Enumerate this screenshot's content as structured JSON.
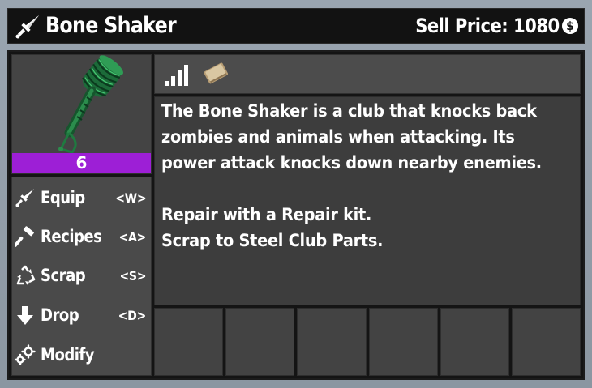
{
  "header": {
    "title": "Bone Shaker",
    "title_icon": "melee-weapon-icon",
    "sell_price_text": "Sell Price: 1080",
    "coin_icon": "dukes-coin-icon"
  },
  "item": {
    "quality_level": "6",
    "quality_color": "#9d1fd6",
    "icon": "bone-shaker-club-icon"
  },
  "stats": {
    "icons": [
      "quality-tier-signal-icon",
      "book-icon"
    ]
  },
  "actions": [
    {
      "label": "Equip",
      "key": "<W>",
      "icon": "sword-icon"
    },
    {
      "label": "Recipes",
      "key": "<A>",
      "icon": "hammer-icon"
    },
    {
      "label": "Scrap",
      "key": "<S>",
      "icon": "recycle-icon"
    },
    {
      "label": "Drop",
      "key": "<D>",
      "icon": "down-arrow-icon"
    },
    {
      "label": "Modify",
      "key": "",
      "icon": "gears-icon"
    }
  ],
  "description": {
    "lines": [
      "The Bone Shaker is a club that knocks back",
      "zombies and animals when attacking. Its",
      "power attack knocks down nearby enemies.",
      "",
      "Repair with a Repair kit.",
      "Scrap to Steel Club Parts."
    ]
  },
  "mod_slots": {
    "count": 6
  }
}
